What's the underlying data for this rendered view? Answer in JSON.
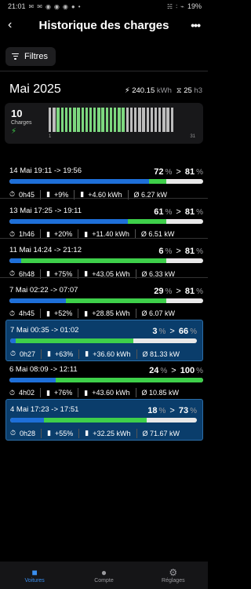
{
  "status_bar": {
    "time": "21:01",
    "left_icons": [
      "✉",
      "✉",
      "◉",
      "◉",
      "◉",
      "●",
      "•"
    ],
    "right_icons": [
      "☵",
      "∶",
      "⌁"
    ],
    "battery": "19%"
  },
  "header": {
    "title": "Historique des charges",
    "back_icon": "‹",
    "more_icon": "•••"
  },
  "filter": {
    "label": "Filtres"
  },
  "month": {
    "title": "Mai 2025",
    "energy_value": "240.15",
    "energy_unit": "kWh",
    "duration_value": "25",
    "duration_unit": "h3"
  },
  "summary": {
    "count": "10",
    "count_label": "Charges",
    "day_start": "1",
    "day_end": "31",
    "days_with_charge": [
      3,
      4,
      5,
      6,
      7,
      8,
      9,
      10,
      11,
      12,
      13,
      14,
      15,
      16,
      17,
      18,
      19
    ]
  },
  "sessions": [
    {
      "date": "14 Mai 19:11 -> 19:56",
      "from": "72",
      "to": "81",
      "duration": "0h45",
      "gain": "+9%",
      "energy": "+4.60 kWh",
      "power": "Ø 6.27 kW",
      "highlight": false
    },
    {
      "date": "13 Mai 17:25 -> 19:11",
      "from": "61",
      "to": "81",
      "duration": "1h46",
      "gain": "+20%",
      "energy": "+11.40 kWh",
      "power": "Ø 6.51 kW",
      "highlight": false
    },
    {
      "date": "11 Mai 14:24 -> 21:12",
      "from": "6",
      "to": "81",
      "duration": "6h48",
      "gain": "+75%",
      "energy": "+43.05 kWh",
      "power": "Ø 6.33 kW",
      "highlight": false
    },
    {
      "date": "7 Mai 02:22 -> 07:07",
      "from": "29",
      "to": "81",
      "duration": "4h45",
      "gain": "+52%",
      "energy": "+28.85 kWh",
      "power": "Ø 6.07 kW",
      "highlight": false
    },
    {
      "date": "7 Mai 00:35 -> 01:02",
      "from": "3",
      "to": "66",
      "duration": "0h27",
      "gain": "+63%",
      "energy": "+36.60 kWh",
      "power": "Ø 81.33 kW",
      "highlight": true
    },
    {
      "date": "6 Mai 08:09 -> 12:11",
      "from": "24",
      "to": "100",
      "duration": "4h02",
      "gain": "+76%",
      "energy": "+43.60 kWh",
      "power": "Ø 10.85 kW",
      "highlight": false
    },
    {
      "date": "4 Mai 17:23 -> 17:51",
      "from": "18",
      "to": "73",
      "duration": "0h28",
      "gain": "+55%",
      "energy": "+32.25 kWh",
      "power": "Ø 71.67 kW",
      "highlight": true
    }
  ],
  "nav": [
    {
      "label": "Voitures",
      "icon": "■",
      "active": true
    },
    {
      "label": "Compte",
      "icon": "●",
      "active": false
    },
    {
      "label": "Réglages",
      "icon": "⚙",
      "active": false
    }
  ],
  "colors": {
    "blue": "#1e6fd8",
    "green": "#3ecf4a",
    "highlight_bg": "#0a3d6b"
  }
}
